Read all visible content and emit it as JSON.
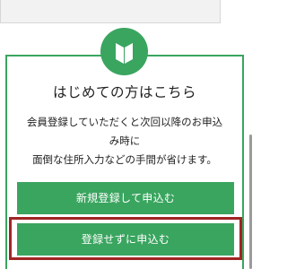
{
  "colors": {
    "accent_green": "#3aa55f",
    "highlight_red": "#a02524",
    "text": "#222222",
    "button_text": "#ffffff"
  },
  "card": {
    "icon": "beginner-mark-icon",
    "heading": "はじめての方はこちら",
    "description_lines": [
      "会員登録していただくと次回以降のお申込",
      "み時に",
      "面倒な住所入力などの手間が省けます。"
    ]
  },
  "buttons": {
    "register_label": "新規登録して申込む",
    "guest_label": "登録せずに申込む"
  }
}
